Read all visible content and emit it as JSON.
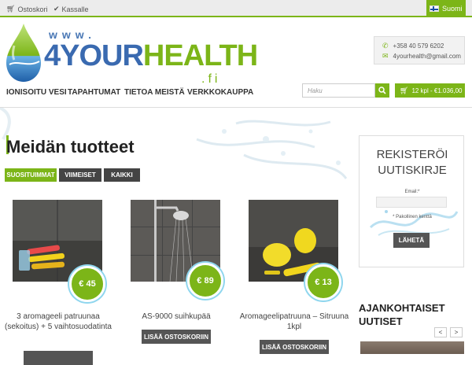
{
  "topbar": {
    "cart_link": "Ostoskori",
    "checkout_link": "Kassalle",
    "language": "Suomi"
  },
  "logo": {
    "www": "www.",
    "part1": "4YOUR",
    "part2": "HEALTH",
    "tld": ".fi"
  },
  "contact": {
    "phone": "+358 40 579 6202",
    "email": "4yourhealth@gmail.com"
  },
  "nav": {
    "items": [
      "IONISOITU VESI",
      "TAPAHTUMAT",
      "TIETOA MEISTÄ",
      "VERKKOKAUPPA"
    ],
    "search_placeholder": "Haku",
    "cart_summary": "12 kpl - €1.036,00"
  },
  "main": {
    "heading": "Meidän tuotteet",
    "tabs": [
      "SUOSITUIMMAT",
      "VIIMEISET",
      "KAIKKI"
    ],
    "products": [
      {
        "title": "3 aromageeli patruunaa (sekoitus) + 5 vaihtosuodatinta",
        "price": "€ 45",
        "button": ""
      },
      {
        "title": "AS-9000 suihkupää",
        "price": "€ 89",
        "button": "LISÄÄ OSTOSKORIIN"
      },
      {
        "title": "Aromageelipatruuna – Sitruuna 1kpl",
        "price": "€ 13",
        "button": "LISÄÄ OSTOSKORIIN"
      }
    ]
  },
  "sidebar": {
    "newsletter_title_line1": "REKISTERÖI",
    "newsletter_title_line2": "UUTISKIRJE",
    "email_label": "Email:*",
    "required_note": "* Pakollinen kenttä",
    "submit": "LÄHETÄ",
    "news_heading_line1": "AJANKOHTAISET",
    "news_heading_line2": "UUTISET",
    "prev": "<",
    "next": ">"
  },
  "colors": {
    "accent": "#7cb518",
    "brand_blue": "#3a6ab0",
    "dark_button": "#555555"
  }
}
